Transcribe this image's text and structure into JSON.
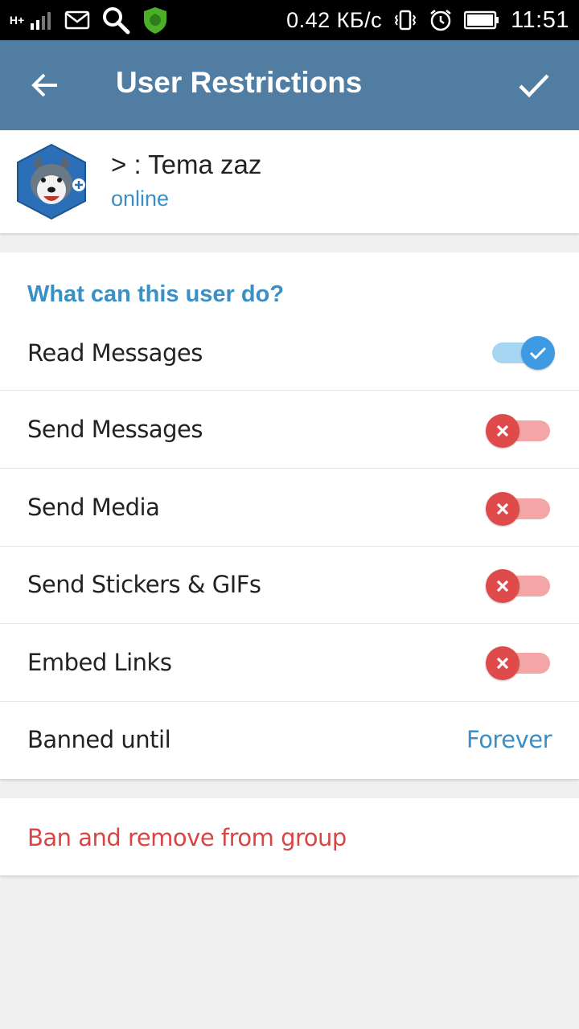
{
  "status_bar": {
    "network_type": "H+",
    "speed": "0.42 КБ/с",
    "time": "11:51",
    "icons": [
      "signal-icon",
      "mail-icon",
      "search-icon",
      "antivirus-icon",
      "vibrate-icon",
      "alarm-icon",
      "battery-icon"
    ]
  },
  "app_bar": {
    "title": "User Restrictions",
    "back_icon": "arrow-left-icon",
    "done_icon": "check-icon",
    "color": "#517da2"
  },
  "profile": {
    "name": "> : Tema zaz",
    "status": "online"
  },
  "permissions": {
    "header": "What can this user do?",
    "items": [
      {
        "label": "Read Messages",
        "enabled": true
      },
      {
        "label": "Send Messages",
        "enabled": false
      },
      {
        "label": "Send Media",
        "enabled": false
      },
      {
        "label": "Send Stickers & GIFs",
        "enabled": false
      },
      {
        "label": "Embed Links",
        "enabled": false
      }
    ],
    "banned_until_label": "Banned until",
    "banned_until_value": "Forever"
  },
  "ban_action": {
    "label": "Ban and remove from group",
    "color": "#d94545"
  },
  "colors": {
    "accent": "#3a8fc5",
    "switch_on": "#3e9ae3",
    "switch_off": "#df4b4b"
  }
}
